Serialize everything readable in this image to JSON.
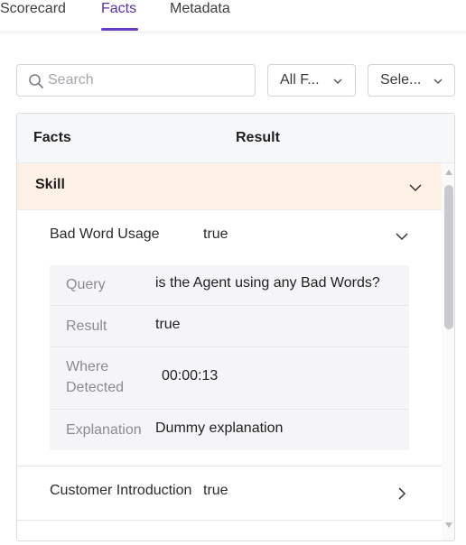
{
  "tabs": [
    {
      "label": "Scorecard",
      "active": false
    },
    {
      "label": "Facts",
      "active": true
    },
    {
      "label": "Metadata",
      "active": false
    }
  ],
  "search": {
    "placeholder": "Search",
    "value": ""
  },
  "filters": {
    "facts_filter_label": "All F...",
    "select_filter_label": "Sele..."
  },
  "table": {
    "headers": {
      "facts": "Facts",
      "result": "Result"
    },
    "group": {
      "label": "Skill",
      "expanded": true
    },
    "facts": [
      {
        "name": "Bad Word Usage",
        "result": "true",
        "expanded": true,
        "details": [
          {
            "label": "Query",
            "value": "is the Agent using any Bad Words?"
          },
          {
            "label": "Result",
            "value": "true"
          },
          {
            "label": "Where Detected",
            "value": "00:00:13"
          },
          {
            "label": "Explanation",
            "value": "Dummy explanation"
          }
        ]
      },
      {
        "name": "Customer Introduction",
        "result": "true",
        "expanded": false
      }
    ]
  },
  "colors": {
    "accent": "#6a3bc7",
    "group_bg": "#fdf0e5",
    "detail_bg": "#f5f5f8"
  },
  "icons": [
    "search-icon",
    "chevron-down-icon",
    "chevron-right-icon"
  ]
}
